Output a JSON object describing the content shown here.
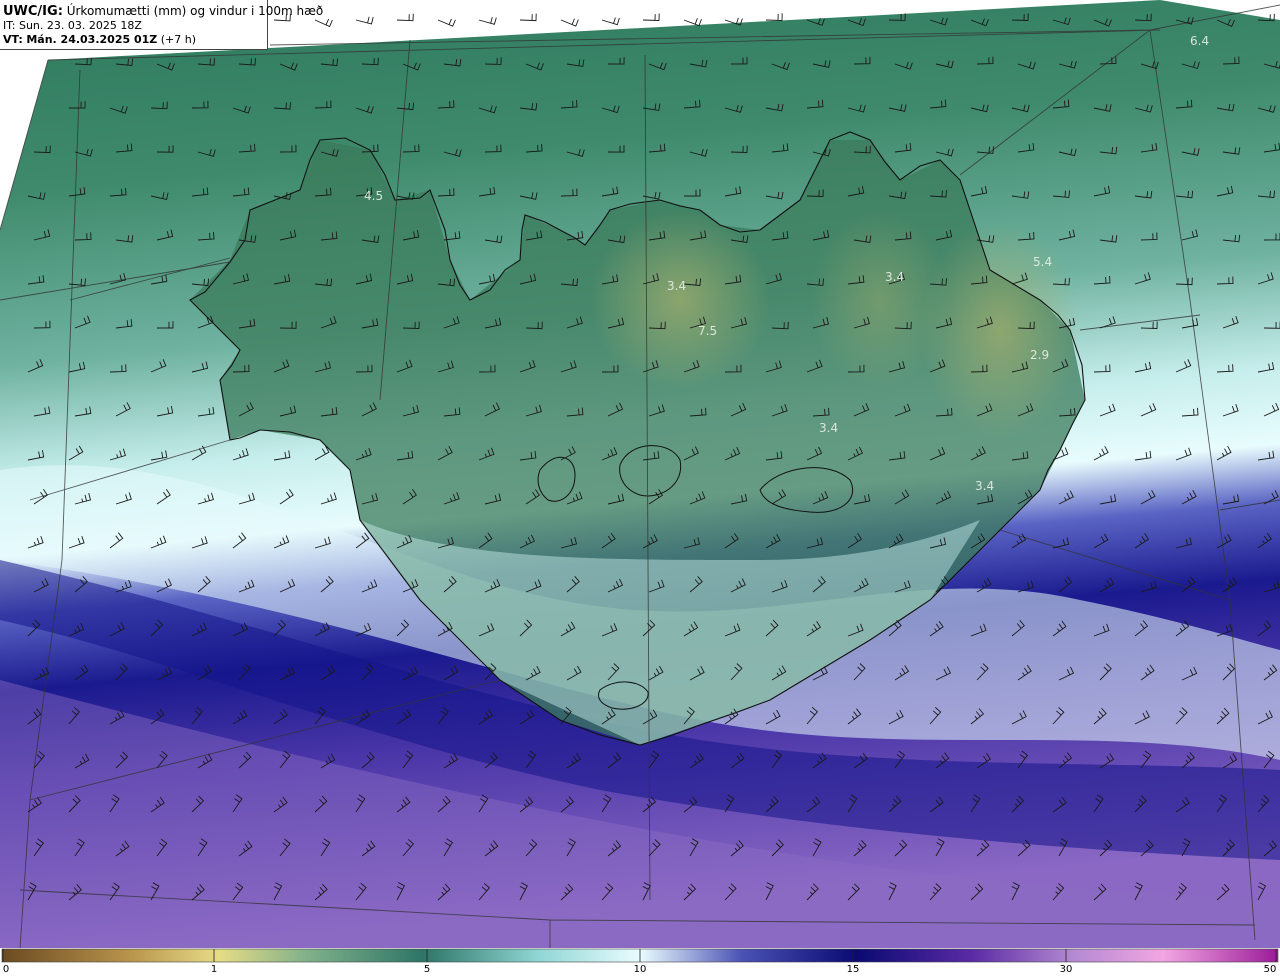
{
  "header": {
    "model": "UWC/IG:",
    "description": "Úrkomumætti (mm) og vindur i 100m hæð",
    "initial_time": "IT: Sun. 23. 03. 2025 18Z",
    "valid_time_prefix": "VT:",
    "valid_time": "Mán. 24.03.2025 01Z",
    "lead": "(+7 h)"
  },
  "map_labels": [
    {
      "id": "label-nw",
      "text": "4.5"
    },
    {
      "id": "label-ne-sea",
      "text": "6.4"
    },
    {
      "id": "label-north-1",
      "text": "3.4"
    },
    {
      "id": "label-north-2",
      "text": "7.5"
    },
    {
      "id": "label-north-3",
      "text": "3.4"
    },
    {
      "id": "label-east-1",
      "text": "5.4"
    },
    {
      "id": "label-east-2",
      "text": "2.9"
    },
    {
      "id": "label-central",
      "text": "3.4"
    },
    {
      "id": "label-east-3",
      "text": "3.4"
    }
  ],
  "colorbar": {
    "ticks": [
      {
        "label": "0",
        "value": 0
      },
      {
        "label": "1",
        "value": 1
      },
      {
        "label": "5",
        "value": 5
      },
      {
        "label": "10",
        "value": 10
      },
      {
        "label": "15",
        "value": 15
      },
      {
        "label": "30",
        "value": 30
      },
      {
        "label": "50",
        "value": 50
      }
    ],
    "colors": [
      "#7a5a2e",
      "#c9a85c",
      "#e8e08a",
      "#6ea88a",
      "#2f7a6a",
      "#a6e6e6",
      "#e8fbff",
      "#3b3fa8",
      "#0a0a78",
      "#5a2aa8",
      "#b488d0",
      "#f0a0e0",
      "#a020a0"
    ]
  },
  "colors": {
    "land_low": "#3d7d5c",
    "land_high": "#8ea86a",
    "sea_north": "#3a8a6c",
    "band_light": "#d8f8f6",
    "band_dark": "#1c1c8c",
    "sea_south": "#7a58b8",
    "barb": "#1a1a1a",
    "coast": "#111111"
  }
}
